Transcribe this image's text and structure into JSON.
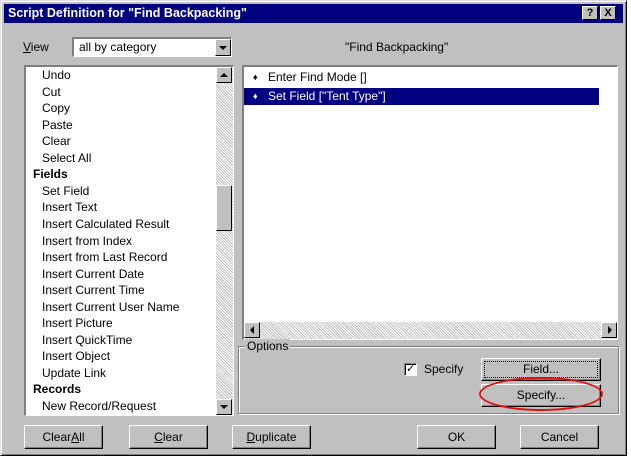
{
  "window": {
    "title": "Script Definition for \"Find Backpacking\"",
    "help_label": "?",
    "close_label": "X"
  },
  "view": {
    "label_prefix": "V",
    "label_rest": "iew",
    "selected": "all by category"
  },
  "script_name": "\"Find Backpacking\"",
  "commands": [
    {
      "text": "Undo",
      "header": false
    },
    {
      "text": "Cut",
      "header": false
    },
    {
      "text": "Copy",
      "header": false
    },
    {
      "text": "Paste",
      "header": false
    },
    {
      "text": "Clear",
      "header": false
    },
    {
      "text": "Select All",
      "header": false
    },
    {
      "text": "Fields",
      "header": true
    },
    {
      "text": "Set Field",
      "header": false
    },
    {
      "text": "Insert Text",
      "header": false
    },
    {
      "text": "Insert Calculated Result",
      "header": false
    },
    {
      "text": "Insert from Index",
      "header": false
    },
    {
      "text": "Insert from Last Record",
      "header": false
    },
    {
      "text": "Insert Current Date",
      "header": false
    },
    {
      "text": "Insert Current Time",
      "header": false
    },
    {
      "text": "Insert Current User Name",
      "header": false
    },
    {
      "text": "Insert Picture",
      "header": false
    },
    {
      "text": "Insert QuickTime",
      "header": false
    },
    {
      "text": "Insert Object",
      "header": false
    },
    {
      "text": "Update Link",
      "header": false
    },
    {
      "text": "Records",
      "header": true
    },
    {
      "text": "New Record/Request",
      "header": false
    }
  ],
  "steps": [
    {
      "text": "Enter Find Mode []",
      "selected": false
    },
    {
      "text": "Set Field [\"Tent Type\"]",
      "selected": true
    }
  ],
  "step_icon": "♦",
  "options": {
    "group_label": "Options",
    "specify_check_label": "Specify",
    "specify_checked": true,
    "specify_check_mark": "✓",
    "field_button": "Field...",
    "specify_button": "Specify..."
  },
  "buttons": {
    "clear_all": {
      "pre": "Clear ",
      "u": "A",
      "post": "ll"
    },
    "clear": {
      "pre": "",
      "u": "C",
      "post": "lear"
    },
    "duplicate": {
      "pre": "",
      "u": "D",
      "post": "uplicate"
    },
    "ok": "OK",
    "cancel": "Cancel"
  },
  "colors": {
    "title_bar": "#000080",
    "selection": "#000080",
    "annotation_circle": "#e01010"
  }
}
